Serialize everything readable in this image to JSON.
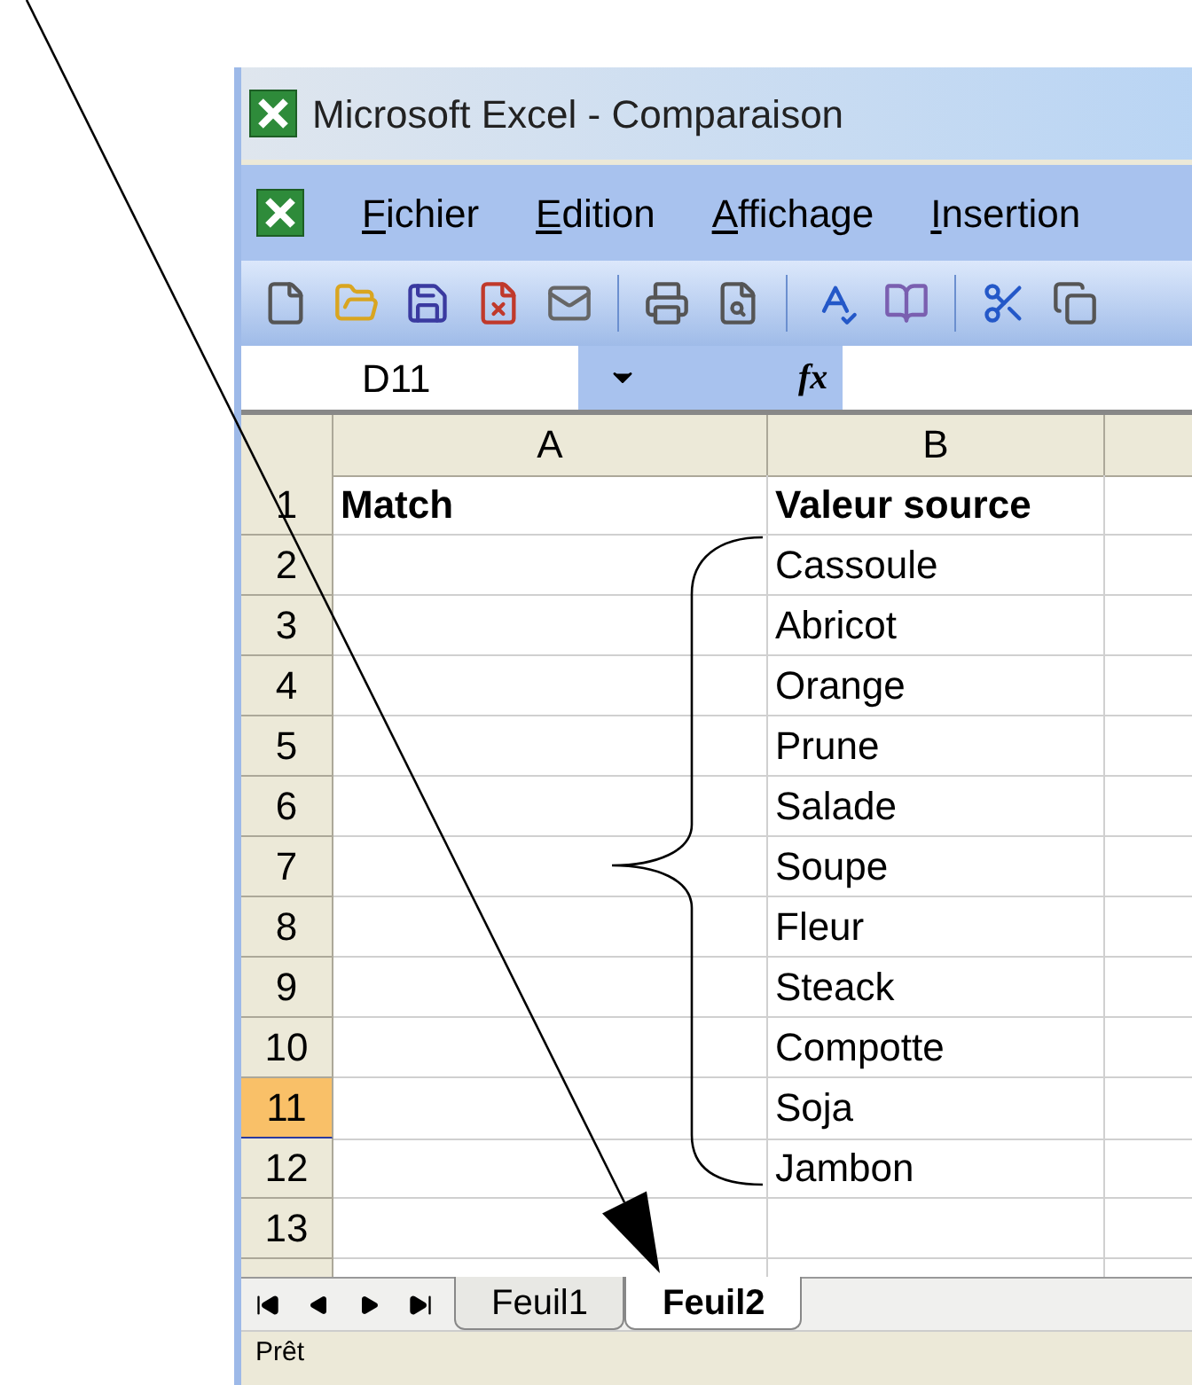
{
  "window": {
    "title": "Microsoft Excel - Comparaison"
  },
  "menu": [
    {
      "label": "Fichier"
    },
    {
      "label": "Edition"
    },
    {
      "label": "Affichage"
    },
    {
      "label": "Insertion"
    }
  ],
  "formula_bar": {
    "name_box": "D11",
    "function_label": "fx"
  },
  "columns": [
    "A",
    "B"
  ],
  "rows": [
    {
      "number": "1",
      "cells": [
        "Match",
        "Valeur source"
      ],
      "bold": true,
      "selected": false
    },
    {
      "number": "2",
      "cells": [
        "",
        "Cassoule"
      ],
      "bold": false,
      "selected": false
    },
    {
      "number": "3",
      "cells": [
        "",
        "Abricot"
      ],
      "bold": false,
      "selected": false
    },
    {
      "number": "4",
      "cells": [
        "",
        "Orange"
      ],
      "bold": false,
      "selected": false
    },
    {
      "number": "5",
      "cells": [
        "",
        "Prune"
      ],
      "bold": false,
      "selected": false
    },
    {
      "number": "6",
      "cells": [
        "",
        "Salade"
      ],
      "bold": false,
      "selected": false
    },
    {
      "number": "7",
      "cells": [
        "",
        "Soupe"
      ],
      "bold": false,
      "selected": false
    },
    {
      "number": "8",
      "cells": [
        "",
        "Fleur"
      ],
      "bold": false,
      "selected": false
    },
    {
      "number": "9",
      "cells": [
        "",
        "Steack"
      ],
      "bold": false,
      "selected": false
    },
    {
      "number": "10",
      "cells": [
        "",
        "Compotte"
      ],
      "bold": false,
      "selected": false
    },
    {
      "number": "11",
      "cells": [
        "",
        "Soja"
      ],
      "bold": false,
      "selected": true
    },
    {
      "number": "12",
      "cells": [
        "",
        "Jambon"
      ],
      "bold": false,
      "selected": false
    },
    {
      "number": "13",
      "cells": [
        "",
        ""
      ],
      "bold": false,
      "selected": false
    }
  ],
  "sheet_tabs": [
    {
      "label": "Feuil1",
      "selected": false
    },
    {
      "label": "Feuil2",
      "selected": true
    }
  ],
  "status_bar": "Prêt"
}
